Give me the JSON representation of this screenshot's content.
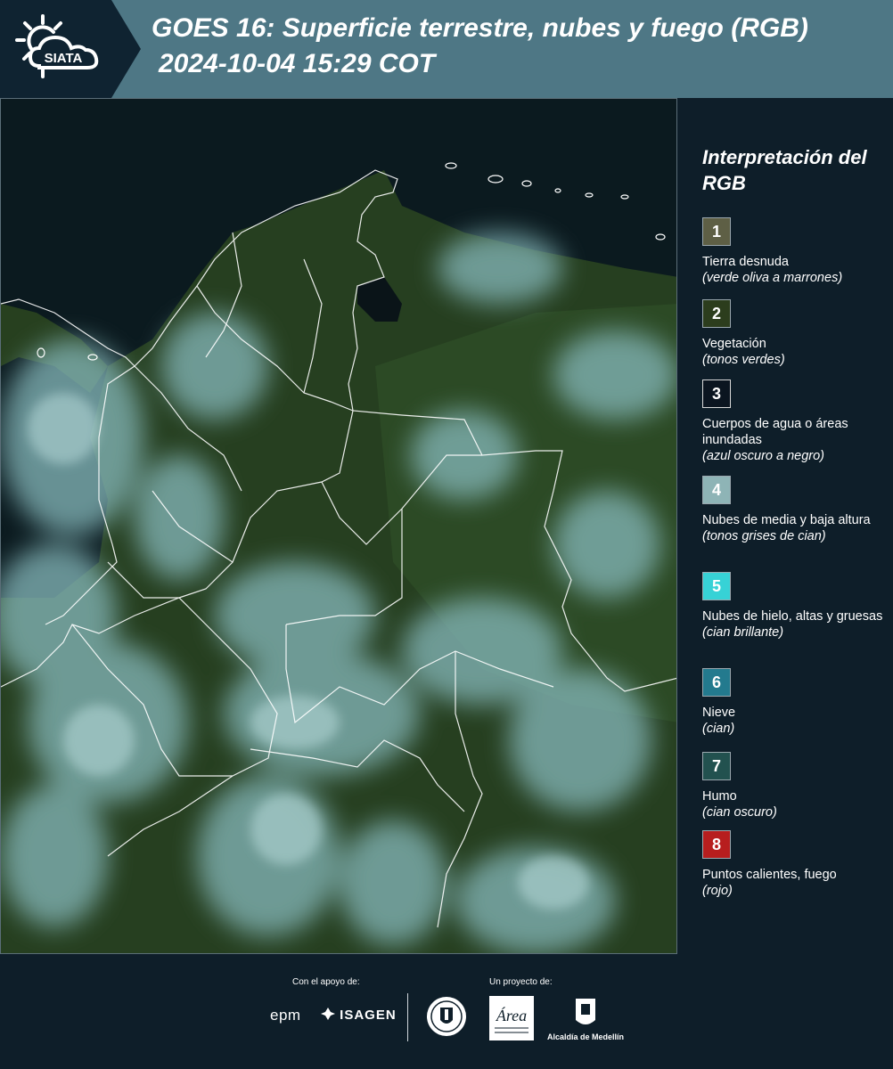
{
  "header": {
    "logo_text": "SIATA",
    "title": "GOES 16: Superficie terrestre, nubes y fuego (RGB)",
    "subtitle": "2024-10-04 15:29 COT"
  },
  "legend": {
    "title": "Interpretación del RGB",
    "items": [
      {
        "num": "1",
        "color": "#5e5f45",
        "label": "Tierra desnuda",
        "desc": "(verde oliva a marrones)"
      },
      {
        "num": "2",
        "color": "#2c3d1d",
        "label": "Vegetación",
        "desc": "(tonos verdes)"
      },
      {
        "num": "3",
        "color": "#0b1520",
        "label": "Cuerpos de agua o áreas inundadas",
        "desc": "(azul oscuro a negro)"
      },
      {
        "num": "4",
        "color": "#8eb4b6",
        "label": "Nubes de media y baja altura",
        "desc": "(tonos grises de cian)"
      },
      {
        "num": "5",
        "color": "#37d2d6",
        "label": "Nubes de hielo, altas y gruesas",
        "desc": "(cian brillante)"
      },
      {
        "num": "6",
        "color": "#237a8e",
        "label": "Nieve",
        "desc": "(cian)"
      },
      {
        "num": "7",
        "color": "#22514f",
        "label": "Humo",
        "desc": "(cian oscuro)"
      },
      {
        "num": "8",
        "color": "#b71e1e",
        "label": "Puntos calientes, fuego",
        "desc": "(rojo)"
      }
    ]
  },
  "footer": {
    "support_label": "Con el apoyo de:",
    "project_label": "Un proyecto de:",
    "epm": "epm",
    "isagen": "ISAGEN",
    "area_text": "Área",
    "alcaldia": "Alcaldía de Medellín"
  },
  "colors": {
    "header_bg": "#4e7785",
    "logo_bg": "#0f2331",
    "page_bg": "#0e1e29",
    "ocean": "#0c1e22",
    "vegetation": "#2c4a26",
    "cloud": "#8ebfc0"
  }
}
